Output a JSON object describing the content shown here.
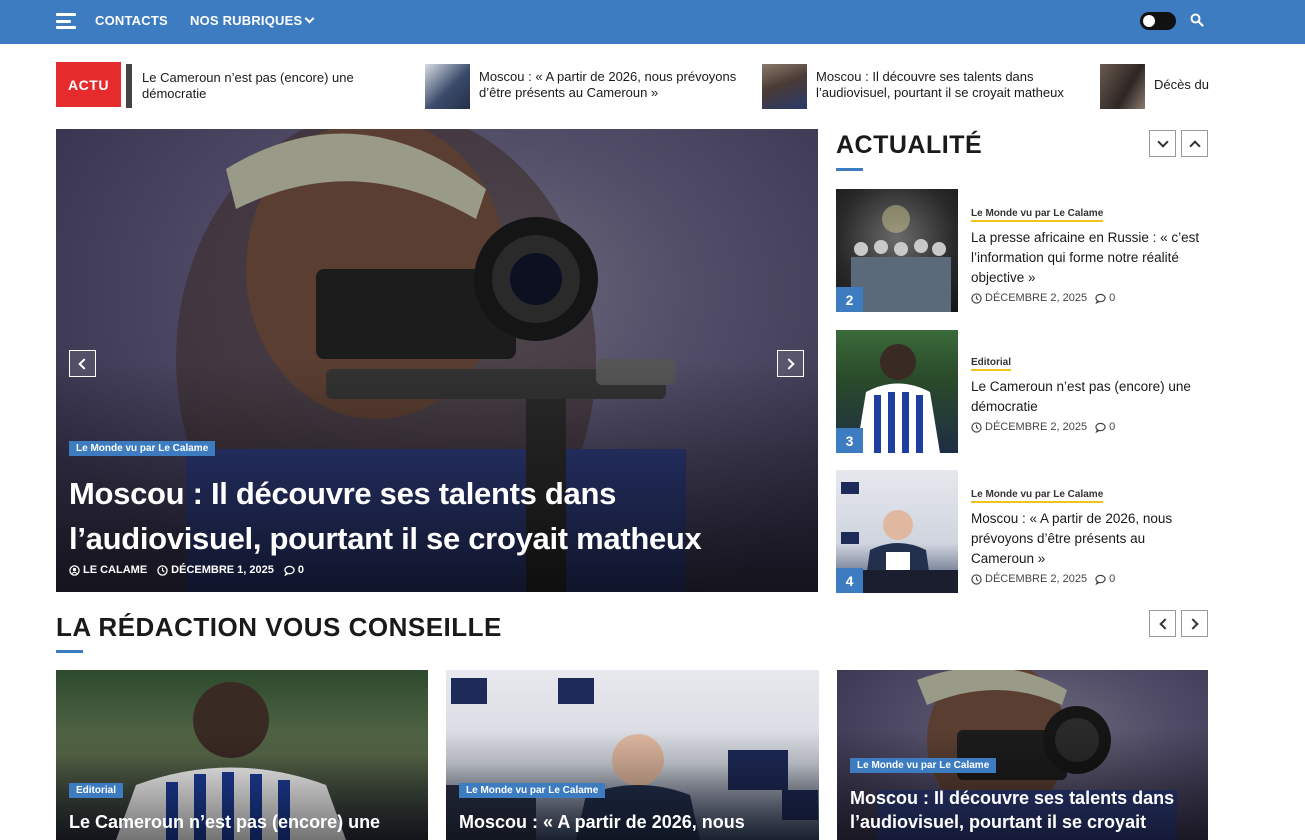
{
  "topbar": {
    "contacts": "CONTACTS",
    "rubriques": "NOS RUBRIQUES"
  },
  "ticker": {
    "badge": "ACTU",
    "items": [
      {
        "title": "Le Cameroun n’est pas (encore) une démocratie"
      },
      {
        "title": "Moscou : « A partir de 2026, nous prévoyons d’être présents au Cameroun »"
      },
      {
        "title": "Moscou : Il découvre ses talents dans l’audiovisuel, pourtant il se croyait matheux"
      },
      {
        "title": "Décès du"
      }
    ]
  },
  "hero": {
    "category": "Le Monde vu par Le Calame",
    "title": "Moscou : Il découvre ses talents dans l’audiovisuel, pourtant il se croyait matheux",
    "author": "LE CALAME",
    "date": "DÉCEMBRE 1, 2025",
    "comments": "0"
  },
  "sidebar": {
    "title": "ACTUALITÉ",
    "items": [
      {
        "rank": "2",
        "category": "Le Monde vu par Le Calame",
        "title": "La presse africaine en Russie : « c’est l’information qui forme notre réalité objective »",
        "date": "DÉCEMBRE 2, 2025",
        "comments": "0"
      },
      {
        "rank": "3",
        "category": "Editorial",
        "title": "Le Cameroun n’est pas (encore) une démocratie",
        "date": "DÉCEMBRE 2, 2025",
        "comments": "0"
      },
      {
        "rank": "4",
        "category": "Le Monde vu par Le Calame",
        "title": "Moscou : « A partir de 2026, nous prévoyons d’être présents au Cameroun »",
        "date": "DÉCEMBRE 2, 2025",
        "comments": "0"
      }
    ]
  },
  "section2": {
    "title": "LA RÉDACTION VOUS CONSEILLE",
    "cards": [
      {
        "category": "Editorial",
        "title": "Le Cameroun n’est pas (encore) une"
      },
      {
        "category": "Le Monde vu par Le Calame",
        "title": "Moscou : « A partir de 2026, nous"
      },
      {
        "category": "Le Monde vu par Le Calame",
        "title": "Moscou : Il découvre ses talents dans l’audiovisuel, pourtant il se croyait"
      }
    ]
  },
  "colors": {
    "primary": "#3d7cc0",
    "actu_red": "#e52b2b",
    "category_underline": "#f0c419"
  }
}
